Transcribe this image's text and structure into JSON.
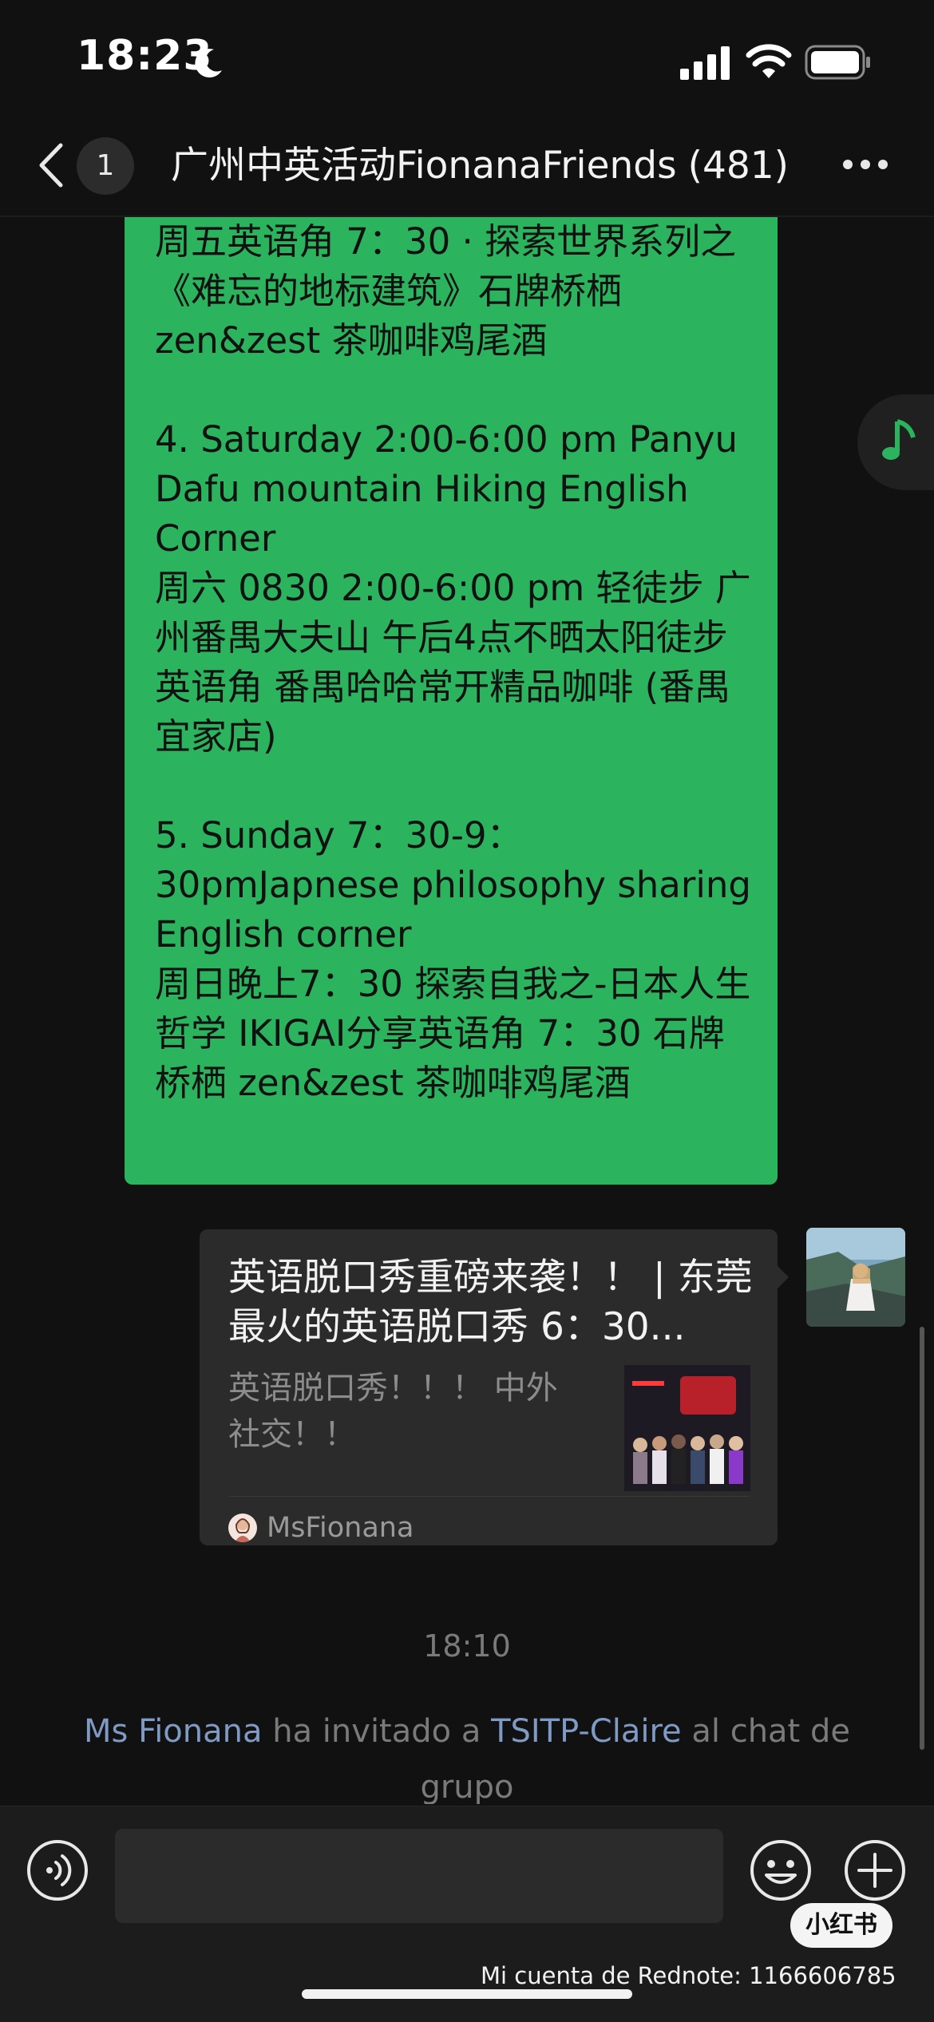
{
  "status_bar": {
    "time": "18:23",
    "icons": [
      "moon-icon",
      "signal-icon",
      "wifi-icon",
      "battery-icon"
    ]
  },
  "nav": {
    "unread_count": "1",
    "title": "广州中英活动FionanaFriends",
    "member_count": "(481)",
    "icons": [
      "back-icon",
      "more-icon"
    ]
  },
  "messages": {
    "event_message_text": "周五英语角 7：30 · 探索世界系列之《难忘的地标建筑》石牌桥栖 zen&zest 茶咖啡鸡尾酒\n\n4. Saturday 2:00-6:00 pm Panyu Dafu mountain Hiking English Corner\n周六 0830 2:00-6:00 pm 轻徒步 广州番禺大夫山 午后4点不晒太阳徒步英语角 番禺哈哈常开精品咖啡 (番禺宜家店)\n\n5. Sunday 7：30-9：30pmJapnese philosophy sharing English corner\n周日晚上7：30 探索自我之-日本人生哲学 IKIGAI分享英语角 7：30 石牌桥栖 zen&zest 茶咖啡鸡尾酒",
    "link_card": {
      "title": "英语脱口秀重磅来袭！！ | 东莞最火的英语脱口秀 6：30...",
      "description": "英语脱口秀！！！ 中外社交！！",
      "source": "MsFionana"
    },
    "time_divider": "18:10",
    "system_message": {
      "inviter": "Ms Fionana",
      "text_1": " ha invitado a ",
      "invitee": "TSITP-Claire",
      "text_2": " al chat de grupo"
    }
  },
  "input_bar": {
    "placeholder": "",
    "icons": [
      "voice-icon",
      "emoji-icon",
      "plus-icon"
    ]
  },
  "watermark": {
    "logo": "小红书",
    "account": "Mi cuenta de Rednote: 1166606785"
  },
  "colors": {
    "background": "#111111",
    "bubble_green": "#2bb35e",
    "link_blue": "#7f9ac4",
    "muted_text": "#7a7a7a"
  }
}
